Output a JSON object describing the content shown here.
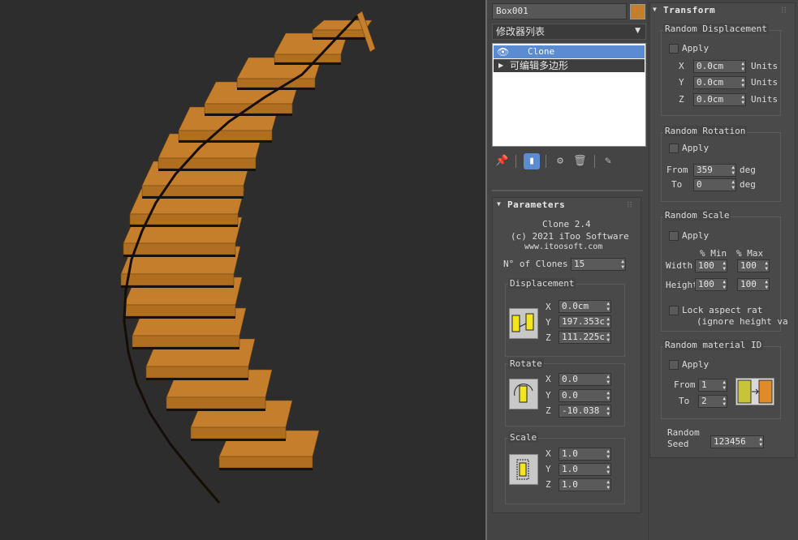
{
  "object": {
    "name": "Box001",
    "color": "#c57f2c"
  },
  "modifier_list": {
    "label": "修改器列表"
  },
  "stack": {
    "items": [
      "Clone",
      "可编辑多边形"
    ]
  },
  "parameters": {
    "title": "Parameters",
    "product": "Clone 2.4",
    "copyright": "(c) 2021 iToo Software",
    "website": "www.itoosoft.com",
    "clones_label": "N° of Clones",
    "clones_value": "15",
    "displacement": {
      "label": "Displacement",
      "x": "0.0cm",
      "y": "197.353c",
      "z": "111.225c"
    },
    "rotate": {
      "label": "Rotate",
      "x": "0.0",
      "y": "0.0",
      "z": "-10.038"
    },
    "scale": {
      "label": "Scale",
      "x": "1.0",
      "y": "1.0",
      "z": "1.0"
    },
    "axis_labels": [
      "X",
      "Y",
      "Z"
    ]
  },
  "transform": {
    "title": "Transform",
    "random_displacement": {
      "label": "Random Displacement",
      "apply": "Apply",
      "x": "0.0cm",
      "y": "0.0cm",
      "z": "0.0cm",
      "units": "Units"
    },
    "random_rotation": {
      "label": "Random Rotation",
      "apply": "Apply",
      "from_label": "From",
      "from_value": "359",
      "to_label": "To",
      "to_value": "0",
      "deg": "deg"
    },
    "random_scale": {
      "label": "Random Scale",
      "apply": "Apply",
      "min_label": "% Min",
      "max_label": "% Max",
      "width_label": "Width",
      "height_label": "Height",
      "width_min": "100",
      "width_max": "100",
      "height_min": "100",
      "height_max": "100",
      "lock_label": "Lock aspect rat",
      "lock_sub": "(ignore height va"
    },
    "random_material": {
      "label": "Random material ID",
      "apply": "Apply",
      "from_label": "From",
      "from_value": "1",
      "to_label": "To",
      "to_value": "2"
    },
    "seed": {
      "label_line1": "Random",
      "label_line2": "Seed",
      "value": "123456"
    }
  }
}
